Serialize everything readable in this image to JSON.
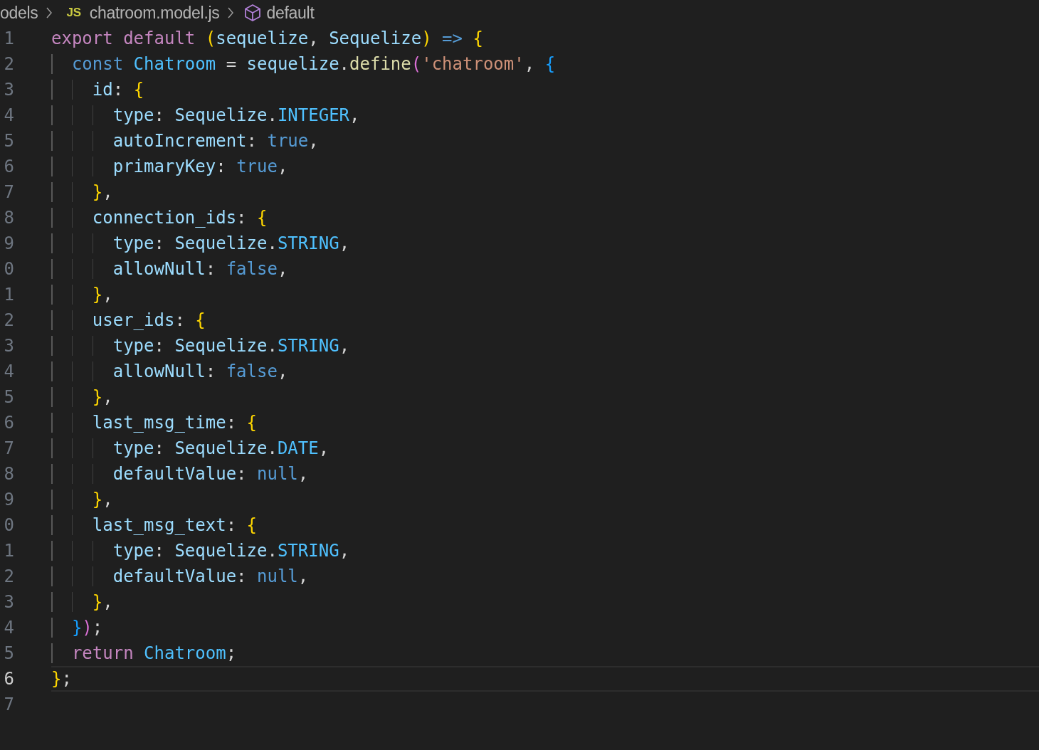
{
  "breadcrumb": [
    {
      "kind": "folder",
      "label": "odels"
    },
    {
      "kind": "file",
      "badge": "JS",
      "label": "chatroom.model.js"
    },
    {
      "kind": "symbol",
      "label": "default"
    }
  ],
  "lines": [
    {
      "number": "1",
      "current": false,
      "tokens": [
        {
          "kind": "keyword",
          "text": "export default "
        },
        {
          "kind": "bracket1",
          "text": "("
        },
        {
          "kind": "variable",
          "text": "sequelize"
        },
        {
          "kind": "plain",
          "text": ", "
        },
        {
          "kind": "variable",
          "text": "Sequelize"
        },
        {
          "kind": "bracket1",
          "text": ")"
        },
        {
          "kind": "storage",
          "text": " => "
        },
        {
          "kind": "bracket1",
          "text": "{"
        }
      ]
    },
    {
      "number": "2",
      "current": false,
      "tokens": [
        {
          "kind": "storage",
          "text": "  const "
        },
        {
          "kind": "constant",
          "text": "Chatroom"
        },
        {
          "kind": "plain",
          "text": " = "
        },
        {
          "kind": "variable",
          "text": "sequelize"
        },
        {
          "kind": "plain",
          "text": "."
        },
        {
          "kind": "function",
          "text": "define"
        },
        {
          "kind": "bracket2",
          "text": "("
        },
        {
          "kind": "string",
          "text": "'chatroom'"
        },
        {
          "kind": "plain",
          "text": ", "
        },
        {
          "kind": "bracket3",
          "text": "{"
        }
      ]
    },
    {
      "number": "3",
      "current": false,
      "tokens": [
        {
          "kind": "variable",
          "text": "    id"
        },
        {
          "kind": "plain",
          "text": ": "
        },
        {
          "kind": "bracket1",
          "text": "{"
        }
      ]
    },
    {
      "number": "4",
      "current": false,
      "tokens": [
        {
          "kind": "variable",
          "text": "      type"
        },
        {
          "kind": "plain",
          "text": ": "
        },
        {
          "kind": "variable",
          "text": "Sequelize"
        },
        {
          "kind": "plain",
          "text": "."
        },
        {
          "kind": "constant",
          "text": "INTEGER"
        },
        {
          "kind": "plain",
          "text": ","
        }
      ]
    },
    {
      "number": "5",
      "current": false,
      "tokens": [
        {
          "kind": "variable",
          "text": "      autoIncrement"
        },
        {
          "kind": "plain",
          "text": ": "
        },
        {
          "kind": "storage",
          "text": "true"
        },
        {
          "kind": "plain",
          "text": ","
        }
      ]
    },
    {
      "number": "6",
      "current": false,
      "tokens": [
        {
          "kind": "variable",
          "text": "      primaryKey"
        },
        {
          "kind": "plain",
          "text": ": "
        },
        {
          "kind": "storage",
          "text": "true"
        },
        {
          "kind": "plain",
          "text": ","
        }
      ]
    },
    {
      "number": "7",
      "current": false,
      "tokens": [
        {
          "kind": "bracket1",
          "text": "    }"
        },
        {
          "kind": "plain",
          "text": ","
        }
      ]
    },
    {
      "number": "8",
      "current": false,
      "tokens": [
        {
          "kind": "variable",
          "text": "    connection_ids"
        },
        {
          "kind": "plain",
          "text": ": "
        },
        {
          "kind": "bracket1",
          "text": "{"
        }
      ]
    },
    {
      "number": "9",
      "current": false,
      "tokens": [
        {
          "kind": "variable",
          "text": "      type"
        },
        {
          "kind": "plain",
          "text": ": "
        },
        {
          "kind": "variable",
          "text": "Sequelize"
        },
        {
          "kind": "plain",
          "text": "."
        },
        {
          "kind": "constant",
          "text": "STRING"
        },
        {
          "kind": "plain",
          "text": ","
        }
      ]
    },
    {
      "number": "0",
      "current": false,
      "tokens": [
        {
          "kind": "variable",
          "text": "      allowNull"
        },
        {
          "kind": "plain",
          "text": ": "
        },
        {
          "kind": "storage",
          "text": "false"
        },
        {
          "kind": "plain",
          "text": ","
        }
      ]
    },
    {
      "number": "1",
      "current": false,
      "tokens": [
        {
          "kind": "bracket1",
          "text": "    }"
        },
        {
          "kind": "plain",
          "text": ","
        }
      ]
    },
    {
      "number": "2",
      "current": false,
      "tokens": [
        {
          "kind": "variable",
          "text": "    user_ids"
        },
        {
          "kind": "plain",
          "text": ": "
        },
        {
          "kind": "bracket1",
          "text": "{"
        }
      ]
    },
    {
      "number": "3",
      "current": false,
      "tokens": [
        {
          "kind": "variable",
          "text": "      type"
        },
        {
          "kind": "plain",
          "text": ": "
        },
        {
          "kind": "variable",
          "text": "Sequelize"
        },
        {
          "kind": "plain",
          "text": "."
        },
        {
          "kind": "constant",
          "text": "STRING"
        },
        {
          "kind": "plain",
          "text": ","
        }
      ]
    },
    {
      "number": "4",
      "current": false,
      "tokens": [
        {
          "kind": "variable",
          "text": "      allowNull"
        },
        {
          "kind": "plain",
          "text": ": "
        },
        {
          "kind": "storage",
          "text": "false"
        },
        {
          "kind": "plain",
          "text": ","
        }
      ]
    },
    {
      "number": "5",
      "current": false,
      "tokens": [
        {
          "kind": "bracket1",
          "text": "    }"
        },
        {
          "kind": "plain",
          "text": ","
        }
      ]
    },
    {
      "number": "6",
      "current": false,
      "tokens": [
        {
          "kind": "variable",
          "text": "    last_msg_time"
        },
        {
          "kind": "plain",
          "text": ": "
        },
        {
          "kind": "bracket1",
          "text": "{"
        }
      ]
    },
    {
      "number": "7",
      "current": false,
      "tokens": [
        {
          "kind": "variable",
          "text": "      type"
        },
        {
          "kind": "plain",
          "text": ": "
        },
        {
          "kind": "variable",
          "text": "Sequelize"
        },
        {
          "kind": "plain",
          "text": "."
        },
        {
          "kind": "constant",
          "text": "DATE"
        },
        {
          "kind": "plain",
          "text": ","
        }
      ]
    },
    {
      "number": "8",
      "current": false,
      "tokens": [
        {
          "kind": "variable",
          "text": "      defaultValue"
        },
        {
          "kind": "plain",
          "text": ": "
        },
        {
          "kind": "storage",
          "text": "null"
        },
        {
          "kind": "plain",
          "text": ","
        }
      ]
    },
    {
      "number": "9",
      "current": false,
      "tokens": [
        {
          "kind": "bracket1",
          "text": "    }"
        },
        {
          "kind": "plain",
          "text": ","
        }
      ]
    },
    {
      "number": "0",
      "current": false,
      "tokens": [
        {
          "kind": "variable",
          "text": "    last_msg_text"
        },
        {
          "kind": "plain",
          "text": ": "
        },
        {
          "kind": "bracket1",
          "text": "{"
        }
      ]
    },
    {
      "number": "1",
      "current": false,
      "tokens": [
        {
          "kind": "variable",
          "text": "      type"
        },
        {
          "kind": "plain",
          "text": ": "
        },
        {
          "kind": "variable",
          "text": "Sequelize"
        },
        {
          "kind": "plain",
          "text": "."
        },
        {
          "kind": "constant",
          "text": "STRING"
        },
        {
          "kind": "plain",
          "text": ","
        }
      ]
    },
    {
      "number": "2",
      "current": false,
      "tokens": [
        {
          "kind": "variable",
          "text": "      defaultValue"
        },
        {
          "kind": "plain",
          "text": ": "
        },
        {
          "kind": "storage",
          "text": "null"
        },
        {
          "kind": "plain",
          "text": ","
        }
      ]
    },
    {
      "number": "3",
      "current": false,
      "tokens": [
        {
          "kind": "bracket1",
          "text": "    }"
        },
        {
          "kind": "plain",
          "text": ","
        }
      ]
    },
    {
      "number": "4",
      "current": false,
      "tokens": [
        {
          "kind": "bracket3",
          "text": "  }"
        },
        {
          "kind": "bracket2",
          "text": ")"
        },
        {
          "kind": "plain",
          "text": ";"
        }
      ]
    },
    {
      "number": "5",
      "current": false,
      "tokens": [
        {
          "kind": "keyword",
          "text": "  return "
        },
        {
          "kind": "constant",
          "text": "Chatroom"
        },
        {
          "kind": "plain",
          "text": ";"
        }
      ]
    },
    {
      "number": "6",
      "current": true,
      "tokens": [
        {
          "kind": "bracket1",
          "text": "}"
        },
        {
          "kind": "plain",
          "text": ";"
        }
      ]
    },
    {
      "number": "7",
      "current": false
    }
  ]
}
